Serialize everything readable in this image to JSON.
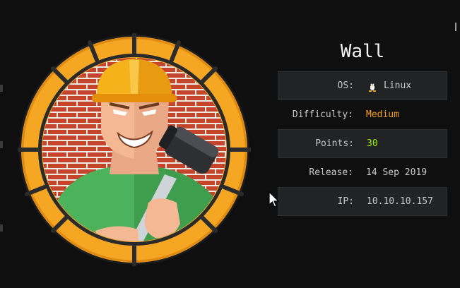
{
  "machine": {
    "name": "Wall",
    "fields": [
      {
        "label": "OS:",
        "value": "Linux",
        "icon": "tux-icon"
      },
      {
        "label": "Difficulty:",
        "value": "Medium"
      },
      {
        "label": "Points:",
        "value": "30"
      },
      {
        "label": "Release:",
        "value": "14 Sep 2019"
      },
      {
        "label": "IP:",
        "value": "10.10.10.157"
      }
    ]
  },
  "colors": {
    "background": "#0f0f10",
    "badge_orange": "#f5a623",
    "difficulty_medium": "#f7a01b",
    "points_green": "#9fef00"
  }
}
